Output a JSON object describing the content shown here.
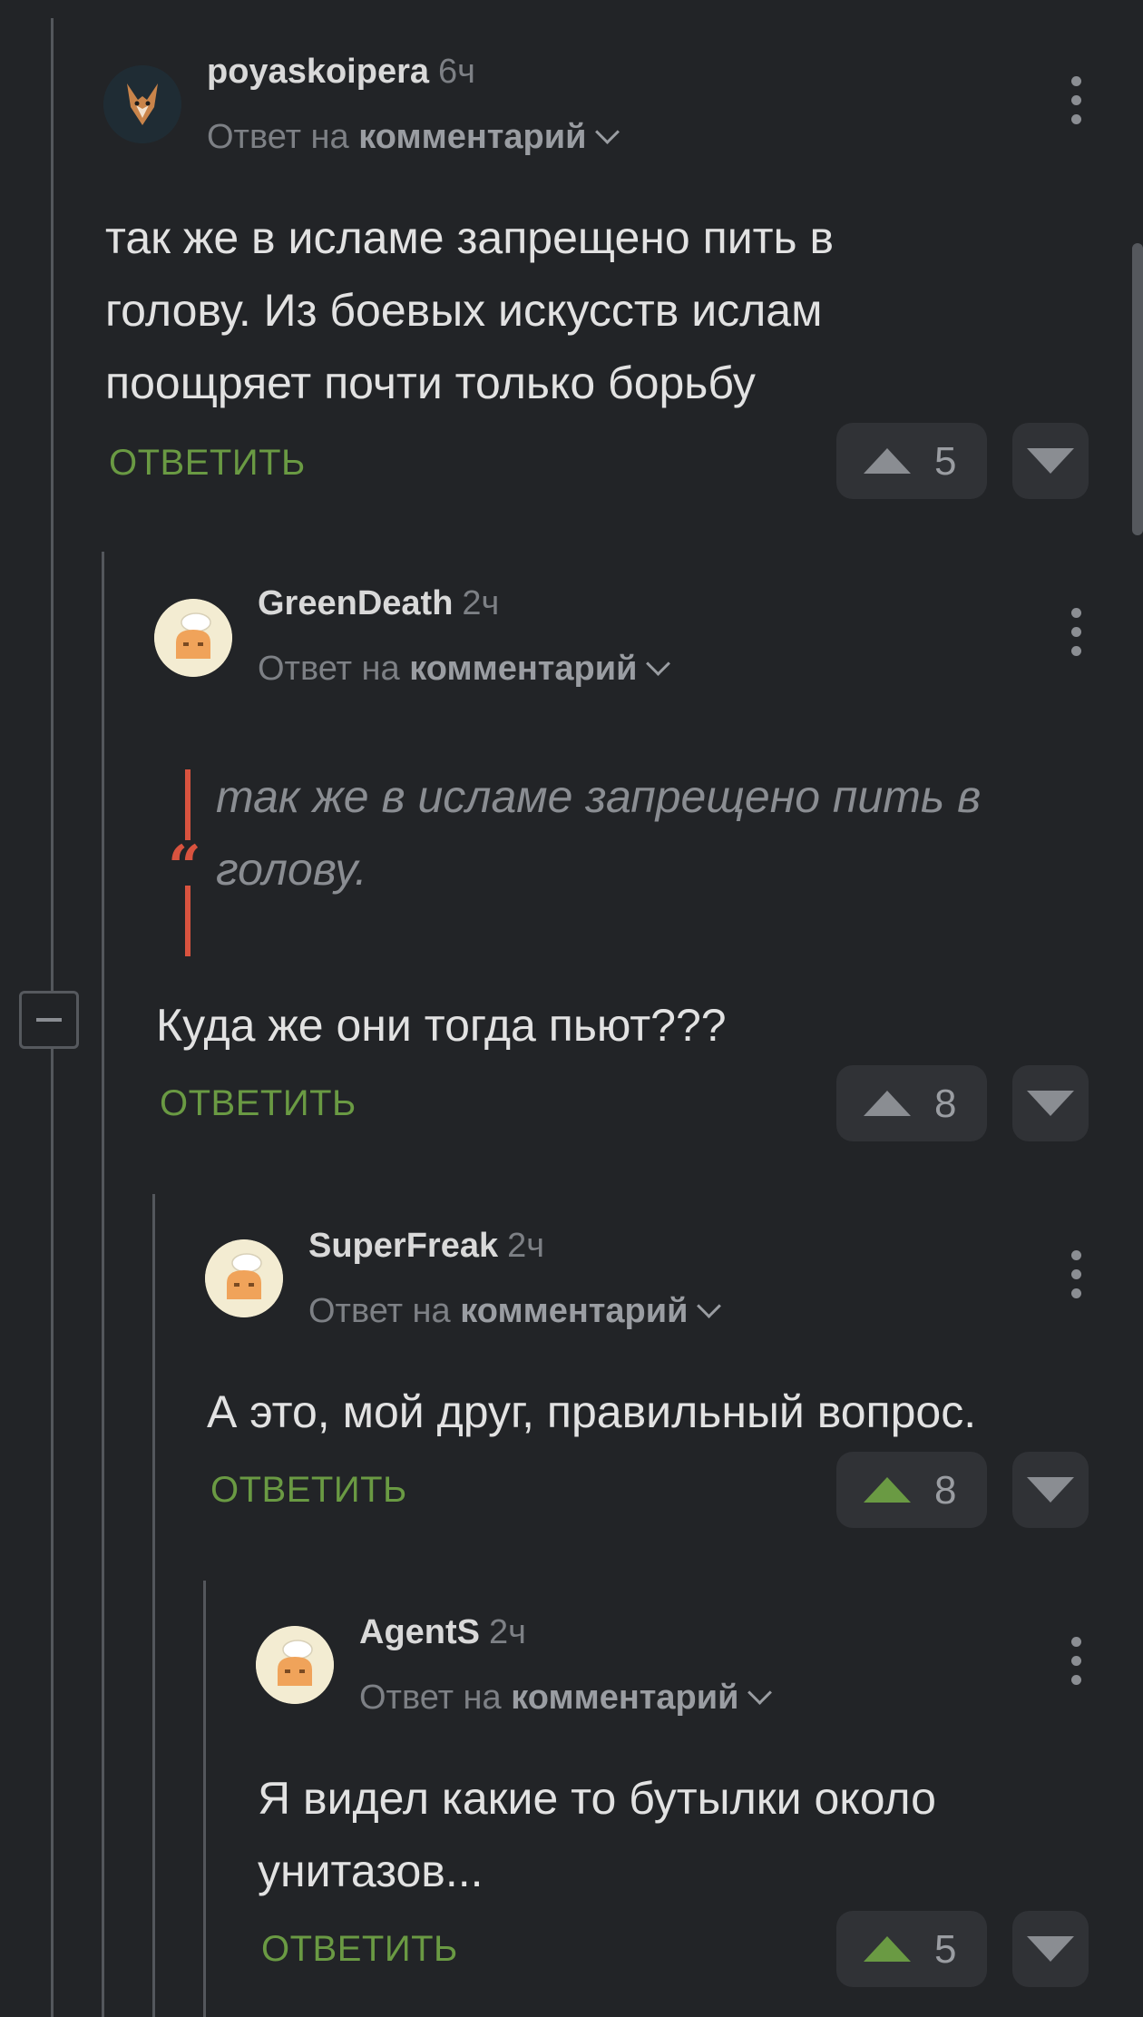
{
  "comments": [
    {
      "author": "poyaskoipera",
      "time": "6ч",
      "reply_prefix": "Ответ на",
      "reply_target": "комментарий",
      "text": "так же в исламе запрещено пить в\nголову. Из боевых искусств ислам\nпоощряет почти только борьбу",
      "reply_label": "ОТВЕТИТЬ",
      "votes": "5",
      "upvoted": false
    },
    {
      "author": "GreenDeath",
      "time": "2ч",
      "reply_prefix": "Ответ на",
      "reply_target": "комментарий",
      "quote": "так же в исламе запрещено пить в\nголову.",
      "text": "Куда же они тогда пьют???",
      "reply_label": "ОТВЕТИТЬ",
      "votes": "8",
      "upvoted": false
    },
    {
      "author": "SuperFreak",
      "time": "2ч",
      "reply_prefix": "Ответ на",
      "reply_target": "комментарий",
      "text": "А это, мой друг, правильный вопрос.",
      "reply_label": "ОТВЕТИТЬ",
      "votes": "8",
      "upvoted": true
    },
    {
      "author": "AgentS",
      "time": "2ч",
      "reply_prefix": "Ответ на",
      "reply_target": "комментарий",
      "text": "Я видел какие то бутылки около\nунитазов...",
      "reply_label": "ОТВЕТИТЬ",
      "votes": "5",
      "upvoted": true
    }
  ],
  "colors": {
    "background": "#222427",
    "accent_green": "#6a9a43",
    "quote_red": "#d9533f"
  },
  "icons": {
    "upvote": "triangle-up-icon",
    "downvote": "triangle-down-icon",
    "menu": "kebab-menu-icon",
    "collapse": "minus-square-icon",
    "quote": "quote-mark-icon"
  }
}
